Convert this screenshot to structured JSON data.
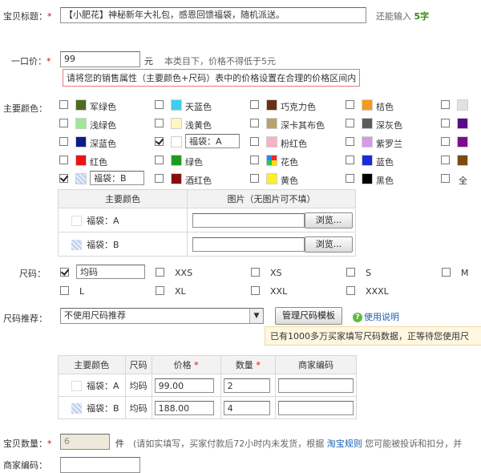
{
  "title_row": {
    "label": "宝贝标题：",
    "value": "【小肥花】神秘新年大礼包，感恩回馈福袋，随机派送。",
    "hint": "还能输入",
    "count": "5字"
  },
  "price_row": {
    "label": "一口价：",
    "value": "99",
    "unit": "元",
    "hint": "本类目下，价格不得低于5元",
    "tip": "请将您的销售属性（主要颜色+尺码）表中的价格设置在合理的价格区间内"
  },
  "color": {
    "label": "主要颜色：",
    "items": [
      {
        "name": "军绿色",
        "color": "#4e6b1f",
        "checked": false
      },
      {
        "name": "天蓝色",
        "color": "#3ccff0",
        "checked": false
      },
      {
        "name": "巧克力色",
        "color": "#6b2f12",
        "checked": false
      },
      {
        "name": "桔色",
        "color": "#f59a1a",
        "checked": false
      },
      {
        "name": "",
        "color": "#e2e2e2",
        "checked": false
      },
      {
        "name": "浅绿色",
        "color": "#9ee79a",
        "checked": false
      },
      {
        "name": "浅黄色",
        "color": "#fdf7c2",
        "checked": false
      },
      {
        "name": "深卡其布色",
        "color": "#b7a36b",
        "checked": false
      },
      {
        "name": "深灰色",
        "color": "#5c5c5c",
        "checked": false
      },
      {
        "name": "",
        "color": "#5a0a8a",
        "checked": false
      },
      {
        "name": "深蓝色",
        "color": "#0b1b8a",
        "checked": false
      },
      {
        "name": "福袋：A",
        "color": "#ffffff",
        "checked": true,
        "editable": true
      },
      {
        "name": "粉红色",
        "color": "#f7b3c4",
        "checked": false
      },
      {
        "name": "紫罗兰",
        "color": "#d59ae8",
        "checked": false
      },
      {
        "name": "",
        "color": "#7b0c8c",
        "checked": false
      },
      {
        "name": "红色",
        "color": "#e81515",
        "checked": false
      },
      {
        "name": "绿色",
        "color": "#1f9a1f",
        "checked": false
      },
      {
        "name": "花色",
        "color": "multi",
        "checked": false
      },
      {
        "name": "蓝色",
        "color": "#1a2bd8",
        "checked": false
      },
      {
        "name": "",
        "color": "#7b4a12",
        "checked": false
      },
      {
        "name": "福袋：B",
        "color": "mosaic",
        "checked": true,
        "editable": true
      },
      {
        "name": "酒红色",
        "color": "#8a0e0e",
        "checked": false
      },
      {
        "name": "黄色",
        "color": "#fbef2a",
        "checked": false
      },
      {
        "name": "黑色",
        "color": "#000000",
        "checked": false
      },
      {
        "name": "全",
        "color": "none",
        "checked": false
      }
    ],
    "image_table": {
      "col1": "主要颜色",
      "col2": "图片（无图片可不填）",
      "rows": [
        {
          "name": "福袋：A",
          "browse": "浏览..."
        },
        {
          "name": "福袋：B",
          "browse": "浏览..."
        }
      ]
    }
  },
  "size": {
    "label": "尺码：",
    "items": [
      {
        "name": "均码",
        "checked": true,
        "editable": true
      },
      {
        "name": "XXS",
        "checked": false
      },
      {
        "name": "XS",
        "checked": false
      },
      {
        "name": "S",
        "checked": false
      },
      {
        "name": "M",
        "checked": false
      },
      {
        "name": "L",
        "checked": false
      },
      {
        "name": "XL",
        "checked": false
      },
      {
        "name": "XXL",
        "checked": false
      },
      {
        "name": "XXXL",
        "checked": false
      }
    ]
  },
  "size_rec": {
    "label": "尺码推荐：",
    "select_value": "不使用尺码推荐",
    "manage_button": "管理尺码模板",
    "help_link": "使用说明",
    "notice": "已有1000多万买家填写尺码数据，正等待您使用尺"
  },
  "sku_table": {
    "headers": [
      "主要颜色",
      "尺码",
      "价格",
      "数量",
      "商家编码"
    ],
    "rows": [
      {
        "color": "福袋：A",
        "size": "均码",
        "price": "99.00",
        "qty": "2",
        "code": ""
      },
      {
        "color": "福袋：B",
        "size": "均码",
        "price": "188.00",
        "qty": "4",
        "code": ""
      }
    ]
  },
  "qty_row": {
    "label": "宝贝数量：",
    "value": "6",
    "unit": "件",
    "hint": "(请如实填写，买家付款后72小时内未发货，根据",
    "link": "淘宝规则",
    "hint2": "您可能被投诉和扣分，并"
  },
  "code_row": {
    "label": "商家编码："
  }
}
